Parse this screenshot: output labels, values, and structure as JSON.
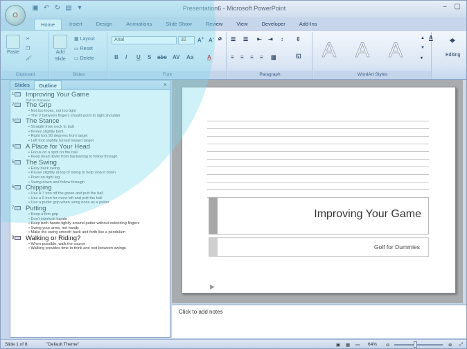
{
  "window": {
    "title": "Presentation6 - Microsoft PowerPoint"
  },
  "office_button": {
    "label": "O"
  },
  "tabs": [
    "Home",
    "Insert",
    "Design",
    "Animations",
    "Slide Show",
    "Review",
    "View",
    "Developer",
    "Add-Ins"
  ],
  "ribbon": {
    "clipboard": {
      "paste": "Paste",
      "label": "Clipboard"
    },
    "slides": {
      "add": "Add",
      "slide": "Slide",
      "layout": "Layout",
      "reset": "Reset",
      "delete": "Delete",
      "label": "Slides"
    },
    "font": {
      "name": "Arial",
      "size": "32",
      "label": "Font"
    },
    "paragraph": {
      "label": "Paragraph"
    },
    "wordart": {
      "label": "WordArt Styles",
      "glyph": "A"
    },
    "editing": {
      "label": "Editing"
    }
  },
  "panel": {
    "tab_slides": "Slides",
    "tab_outline": "Outline",
    "close": "×"
  },
  "outline": [
    {
      "num": "1",
      "title": "Improving Your Game",
      "sub": "Golf for Dummies",
      "bullets": []
    },
    {
      "num": "2",
      "title": "The Grip",
      "bullets": [
        "Not too loose, not too tight",
        "The V between fingers should point to right shoulder"
      ]
    },
    {
      "num": "3",
      "title": "The Stance",
      "bullets": [
        "Straight from neck to butt",
        "Knees slightly bent",
        "Right foot 90 degrees from target",
        "Left foot slightly turned toward target"
      ]
    },
    {
      "num": "4",
      "title": "A Place for Your Head",
      "bullets": [
        "Focus on a spot on the ball",
        "Keep head down from backswing to follow through"
      ]
    },
    {
      "num": "5",
      "title": "The Swing",
      "bullets": [
        "Easy back swing",
        "Pause slightly at top of swing to help slow it down",
        "Pivot on right leg",
        "Swing down and follow through"
      ]
    },
    {
      "num": "6",
      "title": "Chipping",
      "bullets": [
        "Use A 7 iron off the green and putt the ball",
        "Use a 9 iron for more loft and putt the ball",
        "Use a putter grip when using irons as a putter"
      ]
    },
    {
      "num": "7",
      "title": "Putting",
      "bullets": [
        "Keep a firm grip",
        "Don't interlock hands",
        "Keep both hands tightly around putter without extending fingers",
        "Swing your arms, not hands",
        "Make the swing smooth back and forth like a pendulum"
      ]
    },
    {
      "num": "8",
      "title": "Walking or Riding?",
      "bullets": [
        "When possible, walk the course",
        "Walking provides time to think and rest between swings"
      ]
    }
  ],
  "slide": {
    "title": "Improving Your Game",
    "subtitle": "Golf for Dummies"
  },
  "notes": {
    "placeholder": "Click to add notes"
  },
  "status": {
    "slide_info": "Slide 1 of 8",
    "theme": "\"Default Theme\"",
    "zoom": "64%"
  }
}
